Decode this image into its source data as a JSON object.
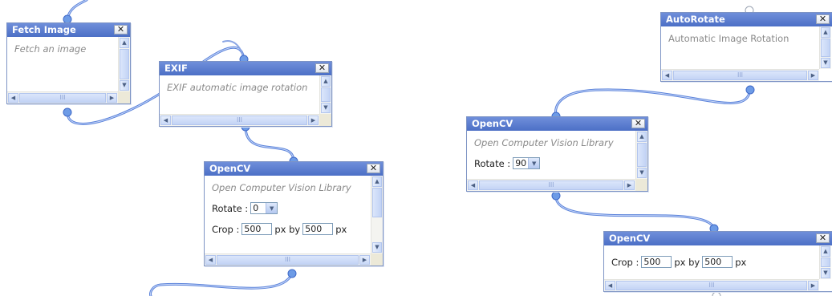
{
  "close_glyph": "✕",
  "scroll": {
    "up": "▲",
    "down": "▼",
    "left": "◀",
    "right": "▶",
    "grip": "III",
    "select_arrow": "▼"
  },
  "nodes": {
    "fetch_image": {
      "title": "Fetch Image",
      "description": "Fetch an image"
    },
    "exif": {
      "title": "EXIF",
      "description": "EXIF automatic image rotation"
    },
    "opencv_left": {
      "title": "OpenCV",
      "description": "Open Computer Vision Library",
      "rotate_label": "Rotate :",
      "rotate_value": "0",
      "crop_label": "Crop :",
      "crop_width": "500",
      "crop_by": "px by",
      "crop_height": "500",
      "crop_unit": "px"
    },
    "autorotate": {
      "title": "AutoRotate",
      "description": "Automatic Image Rotation"
    },
    "opencv_rotate": {
      "title": "OpenCV",
      "description": "Open Computer Vision Library",
      "rotate_label": "Rotate :",
      "rotate_value": "90"
    },
    "opencv_crop": {
      "title": "OpenCV",
      "crop_label": "Crop :",
      "crop_width": "500",
      "crop_by": "px by",
      "crop_height": "500",
      "crop_unit": "px"
    }
  },
  "colors": {
    "titlebar": "#5577cc",
    "wire": "#5a82da",
    "wire_highlight": "#c9d8f8",
    "terminal": "#6d9be6",
    "terminal_unconnected": "#ffffff"
  }
}
